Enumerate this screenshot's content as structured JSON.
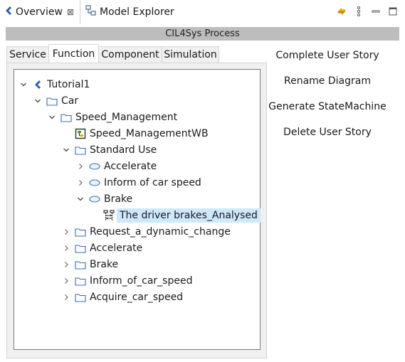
{
  "view_tabs": {
    "active": {
      "label": "Overview",
      "icon": "overview-chevron-icon",
      "close": "⊠"
    },
    "inactive": {
      "label": "Model Explorer",
      "icon": "model-explorer-icon"
    }
  },
  "view_actions": [
    "sync-icon",
    "view-menu-icon",
    "minimize-icon",
    "maximize-icon"
  ],
  "process_title": "CIL4Sys Process",
  "inner_tabs": [
    {
      "label": "Service",
      "selected": false
    },
    {
      "label": "Function",
      "selected": true
    },
    {
      "label": "Component",
      "selected": false
    },
    {
      "label": "Simulation",
      "selected": false
    }
  ],
  "tree": [
    {
      "label": "Tutorial1",
      "icon": "project-icon",
      "twisty": "expanded",
      "level": 0
    },
    {
      "label": "Car",
      "icon": "folder-icon",
      "twisty": "expanded",
      "level": 1
    },
    {
      "label": "Speed_Management",
      "icon": "folder-icon",
      "twisty": "expanded",
      "level": 2
    },
    {
      "label": "Speed_ManagementWB",
      "icon": "whiteboard-icon",
      "twisty": "none",
      "level": 3
    },
    {
      "label": "Standard Use",
      "icon": "folder-icon",
      "twisty": "expanded",
      "level": 3
    },
    {
      "label": "Accelerate",
      "icon": "use-case-icon",
      "twisty": "collapsed",
      "level": 4
    },
    {
      "label": "Inform of car speed",
      "icon": "use-case-icon",
      "twisty": "collapsed",
      "level": 4
    },
    {
      "label": "Brake",
      "icon": "use-case-icon",
      "twisty": "expanded",
      "level": 4
    },
    {
      "label": "The driver brakes_Analysed",
      "icon": "sequence-diagram-icon",
      "twisty": "none",
      "level": 5,
      "selected": true
    },
    {
      "label": "Request_a_dynamic_change",
      "icon": "folder-icon",
      "twisty": "collapsed",
      "level": 3
    },
    {
      "label": "Accelerate",
      "icon": "folder-icon",
      "twisty": "collapsed",
      "level": 3
    },
    {
      "label": "Brake",
      "icon": "folder-icon",
      "twisty": "collapsed",
      "level": 3
    },
    {
      "label": "Inform_of_car_speed",
      "icon": "folder-icon",
      "twisty": "collapsed",
      "level": 3
    },
    {
      "label": "Acquire_car_speed",
      "icon": "folder-icon",
      "twisty": "collapsed",
      "level": 3
    }
  ],
  "actions": [
    "Complete User Story",
    "Rename Diagram",
    "Generate StateMachine",
    "Delete User Story"
  ],
  "colors": {
    "header_bg": "#bdbdbd",
    "selection_bg": "#cde8ff",
    "folder_stroke": "#3b6ea8",
    "accent_blue": "#2b5fa8"
  }
}
